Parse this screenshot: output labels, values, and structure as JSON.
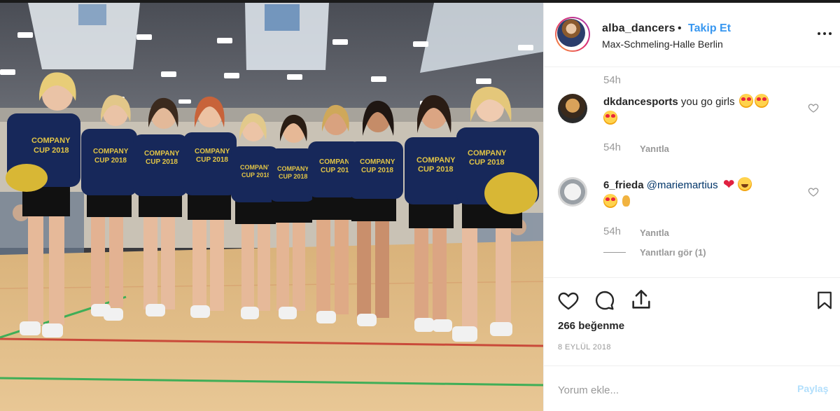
{
  "post": {
    "username": "alba_dancers",
    "separator": "•",
    "follow_label": "Takip Et",
    "location": "Max-Schmeling-Halle Berlin",
    "more_icon": "more-options-icon"
  },
  "photo": {
    "shirt_text_line1": "COMPANY",
    "shirt_text_line2": "CUP 2018"
  },
  "comments": {
    "top_timestamp": "54h",
    "items": [
      {
        "username": "dkdancesports",
        "text": "you go girls",
        "emojis": [
          "heart-eyes",
          "heart-eyes",
          "heart-eyes"
        ],
        "timestamp": "54h",
        "reply_label": "Yanıtla"
      },
      {
        "username": "6_frieda",
        "mention": "@mariemartius",
        "emojis": [
          "red-heart",
          "grinning",
          "heart-eyes",
          "ok-hand"
        ],
        "timestamp": "54h",
        "reply_label": "Yanıtla",
        "view_replies_label": "Yanıtları gör (1)"
      }
    ]
  },
  "actions": {
    "icons": [
      "like-heart-icon",
      "comment-bubble-icon",
      "share-icon",
      "save-bookmark-icon"
    ],
    "likes_label": "266 beğenme",
    "date_label": "8 EYLÜL 2018"
  },
  "add_comment": {
    "placeholder": "Yorum ekle...",
    "post_label": "Paylaş"
  },
  "colors": {
    "accent": "#3897f0",
    "post_disabled": "#b2dffc",
    "text": "#262626",
    "muted": "#999999"
  }
}
